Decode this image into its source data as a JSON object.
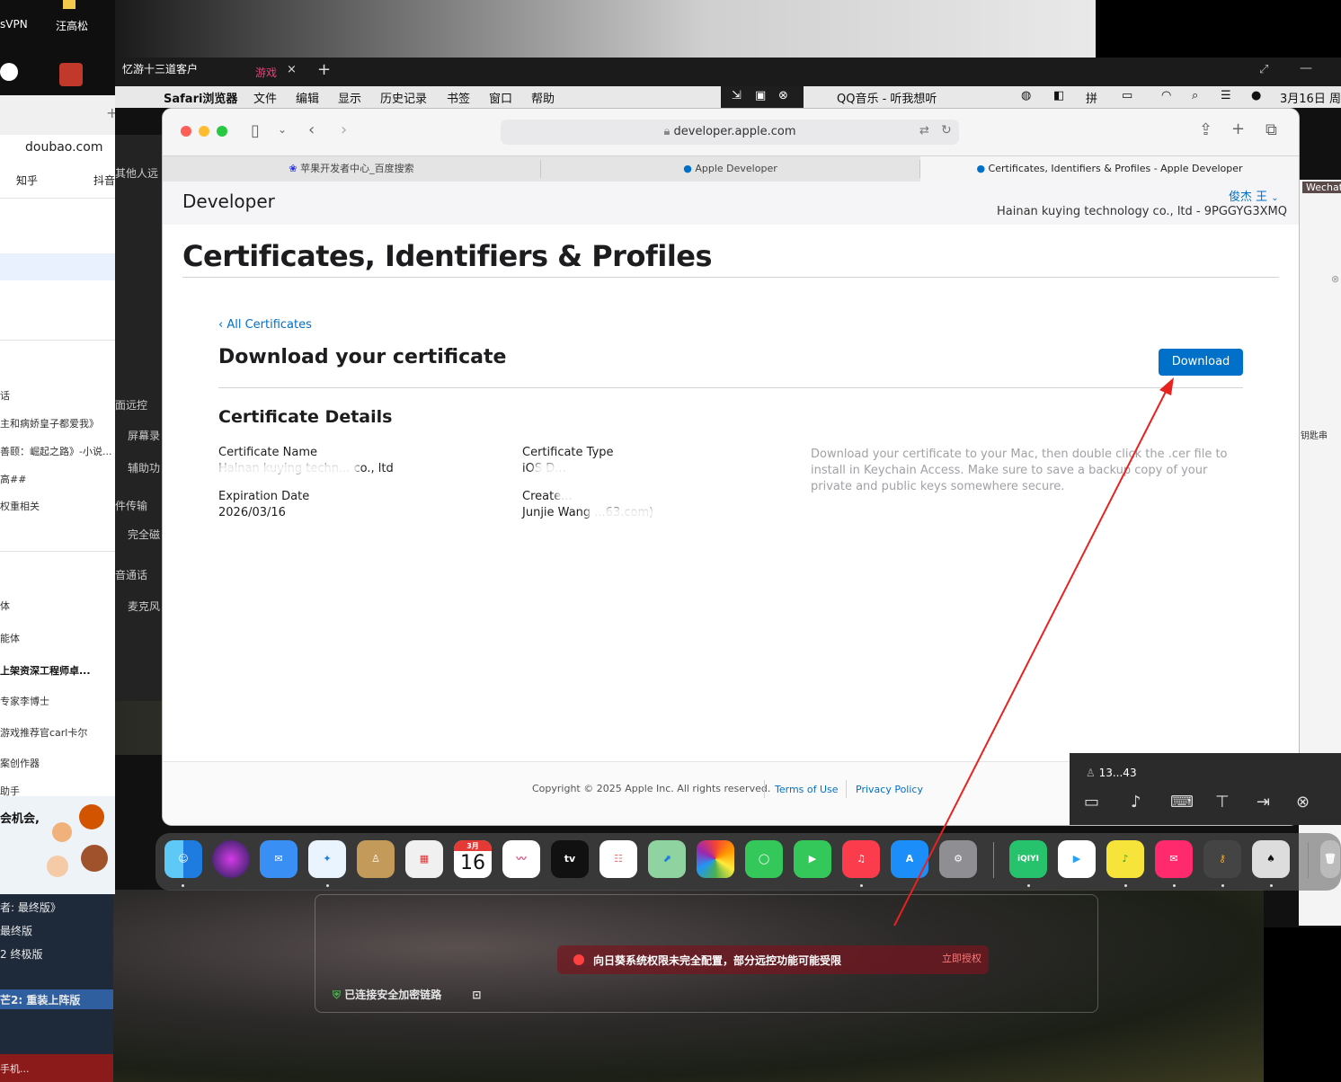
{
  "desktop": {
    "icons": [
      "sVPN",
      "汪高松"
    ]
  },
  "left_panel": {
    "doubao": "doubao.com",
    "bookmarks": [
      "知乎",
      "抖音"
    ],
    "list": [
      "话",
      "主和病娇皇子都爱我》",
      "善颐：崛起之路》-小说...",
      "高##",
      "权重相关",
      "体",
      "能体",
      "上架资深工程师卓...",
      "专家李博士",
      "游戏推荐官carl卡尔",
      "案创作器",
      "助手"
    ],
    "promo": "会机会,",
    "dark_list": [
      "者: 最终版》",
      "最终版",
      "2 终极版",
      "芒2: 重装上阵版"
    ],
    "bottom_text": "手机..."
  },
  "remote_panel": {
    "items": [
      "其他人远",
      "面远控",
      "屏幕录",
      "辅助功",
      "件传输",
      "完全磁",
      "音通话",
      "麦克风"
    ]
  },
  "right_panel": {
    "wechat": "Wechat",
    "keychain": "钥匙串"
  },
  "client_bar": {
    "tab_title": "忆游十三道客户",
    "tab_game": "游戏",
    "close": "×",
    "new_tab": "+"
  },
  "menubar": {
    "items": [
      "Safari浏览器",
      "文件",
      "编辑",
      "显示",
      "历史记录",
      "书签",
      "窗口",
      "帮助"
    ],
    "now_playing": "QQ音乐 - 听我想听",
    "date": "3月16日 周"
  },
  "safari": {
    "url": "developer.apple.com",
    "tabs": [
      {
        "label": "苹果开发者中心_百度搜索"
      },
      {
        "label": "Apple Developer"
      },
      {
        "label": "Certificates, Identifiers & Profiles - Apple Developer"
      }
    ]
  },
  "page": {
    "logo": "Developer",
    "user_name": "俊杰 王",
    "team": "Hainan kuying technology co., ltd - 9PGGYG3XMQ",
    "title": "Certificates, Identifiers & Profiles",
    "back_link": "‹ All Certificates",
    "download_heading": "Download your certificate",
    "download_button": "Download",
    "details_heading": "Certificate Details",
    "fields": {
      "name_label": "Certificate Name",
      "name_value": "Hainan kuying techn... co., ltd",
      "type_label": "Certificate Type",
      "type_value": "iOS D...",
      "expiration_label": "Expiration Date",
      "expiration_value": "2026/03/16",
      "created_label": "Create...",
      "created_value": "Junjie Wang ...63.com)"
    },
    "help_text": "Download your certificate to your Mac, then double click the .cer file to install in Keychain Access. Make sure to save a backup copy of your private and public keys somewhere secure.",
    "footer": {
      "copyright": "Copyright © 2025 Apple Inc. All rights reserved.",
      "terms": "Terms of Use",
      "privacy": "Privacy Policy"
    }
  },
  "mini_bar": {
    "user": "13...43"
  },
  "dock": {
    "calendar_month": "3月",
    "calendar_day": "16",
    "tv_label": "tv",
    "iqiyi_label": "iQIYI"
  },
  "remote_notice": {
    "warning": "向日葵系统权限未完全配置，部分远控功能可能受限",
    "action": "立即授权",
    "secure": "已连接安全加密链路"
  },
  "colors": {
    "accent_blue": "#0070c9",
    "annotation_red": "#e8221f"
  }
}
